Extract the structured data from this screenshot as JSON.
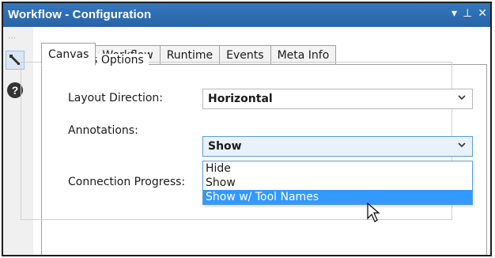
{
  "window": {
    "title": "Workflow - Configuration",
    "icons": {
      "dropdown": "▾",
      "pin": "⊥",
      "close": "✕"
    }
  },
  "sidebar": {
    "grip": "⋯",
    "items": [
      {
        "name": "wrench-icon",
        "active": true
      },
      {
        "name": "help-icon",
        "glyph": "?"
      }
    ]
  },
  "tabs": [
    {
      "label": "Canvas",
      "active": true
    },
    {
      "label": "Workflow"
    },
    {
      "label": "Runtime"
    },
    {
      "label": "Events"
    },
    {
      "label": "Meta Info"
    }
  ],
  "canvas_options": {
    "title": "Canvas Options",
    "layout_direction": {
      "label": "Layout Direction:",
      "value": "Horizontal"
    },
    "annotations": {
      "label": "Annotations:",
      "value": "Show",
      "options": [
        "Hide",
        "Show",
        "Show w/ Tool Names"
      ],
      "highlighted": "Show w/ Tool Names"
    },
    "connection_progress": {
      "label": "Connection Progress:"
    }
  },
  "colors": {
    "titlebar": "#2b6cb0",
    "highlight": "#3399ff",
    "focus_border": "#5b9bd5"
  }
}
